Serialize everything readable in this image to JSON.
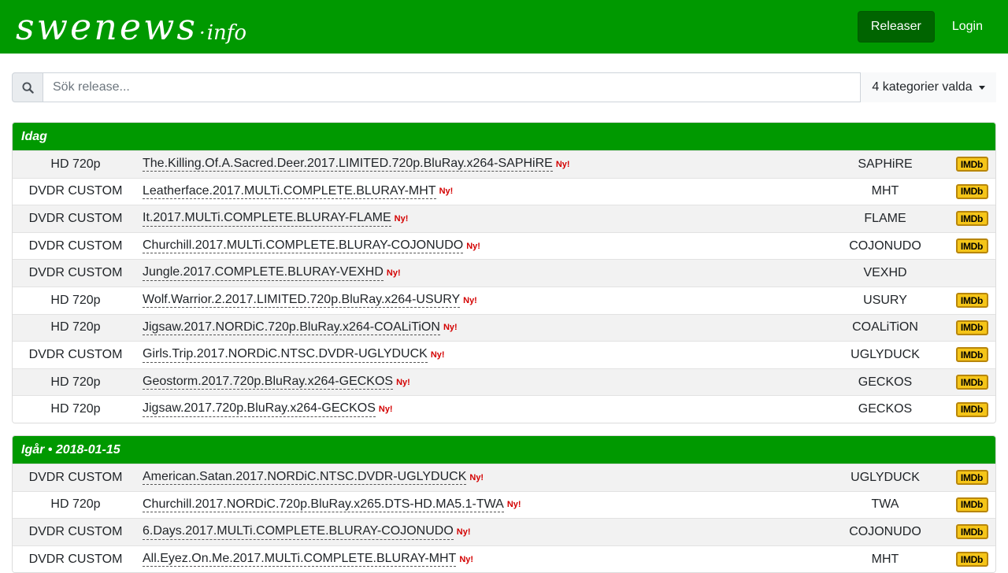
{
  "header": {
    "brand_main": "swenews",
    "brand_dot": "·",
    "brand_tld": "info",
    "nav": [
      {
        "label": "Releaser",
        "active": true
      },
      {
        "label": "Login",
        "active": false
      }
    ]
  },
  "search": {
    "placeholder": "Sök release...",
    "value": "",
    "icon": "search-icon",
    "categories_label": "4 kategorier valda"
  },
  "badge_new": "Ny!",
  "imdb_label": "IMDb",
  "colors": {
    "brand_green": "#009900",
    "active_nav": "#006400",
    "new_badge": "#d40000",
    "imdb_yellow": "#f5c518"
  },
  "sections": [
    {
      "title": "Idag",
      "rows": [
        {
          "category": "HD 720p",
          "release": "The.Killing.Of.A.Sacred.Deer.2017.LIMITED.720p.BluRay.x264-SAPHiRE",
          "group": "SAPHiRE",
          "imdb": true
        },
        {
          "category": "DVDR CUSTOM",
          "release": "Leatherface.2017.MULTi.COMPLETE.BLURAY-MHT",
          "group": "MHT",
          "imdb": true
        },
        {
          "category": "DVDR CUSTOM",
          "release": "It.2017.MULTi.COMPLETE.BLURAY-FLAME",
          "group": "FLAME",
          "imdb": true
        },
        {
          "category": "DVDR CUSTOM",
          "release": "Churchill.2017.MULTi.COMPLETE.BLURAY-COJONUDO",
          "group": "COJONUDO",
          "imdb": true
        },
        {
          "category": "DVDR CUSTOM",
          "release": "Jungle.2017.COMPLETE.BLURAY-VEXHD",
          "group": "VEXHD",
          "imdb": false
        },
        {
          "category": "HD 720p",
          "release": "Wolf.Warrior.2.2017.LIMITED.720p.BluRay.x264-USURY",
          "group": "USURY",
          "imdb": true
        },
        {
          "category": "HD 720p",
          "release": "Jigsaw.2017.NORDiC.720p.BluRay.x264-COALiTiON",
          "group": "COALiTiON",
          "imdb": true
        },
        {
          "category": "DVDR CUSTOM",
          "release": "Girls.Trip.2017.NORDiC.NTSC.DVDR-UGLYDUCK",
          "group": "UGLYDUCK",
          "imdb": true
        },
        {
          "category": "HD 720p",
          "release": "Geostorm.2017.720p.BluRay.x264-GECKOS",
          "group": "GECKOS",
          "imdb": true
        },
        {
          "category": "HD 720p",
          "release": "Jigsaw.2017.720p.BluRay.x264-GECKOS",
          "group": "GECKOS",
          "imdb": true
        }
      ]
    },
    {
      "title": "Igår • 2018-01-15",
      "rows": [
        {
          "category": "DVDR CUSTOM",
          "release": "American.Satan.2017.NORDiC.NTSC.DVDR-UGLYDUCK",
          "group": "UGLYDUCK",
          "imdb": true
        },
        {
          "category": "HD 720p",
          "release": "Churchill.2017.NORDiC.720p.BluRay.x265.DTS-HD.MA5.1-TWA",
          "group": "TWA",
          "imdb": true
        },
        {
          "category": "DVDR CUSTOM",
          "release": "6.Days.2017.MULTi.COMPLETE.BLURAY-COJONUDO",
          "group": "COJONUDO",
          "imdb": true
        },
        {
          "category": "DVDR CUSTOM",
          "release": "All.Eyez.On.Me.2017.MULTi.COMPLETE.BLURAY-MHT",
          "group": "MHT",
          "imdb": true
        }
      ]
    }
  ]
}
